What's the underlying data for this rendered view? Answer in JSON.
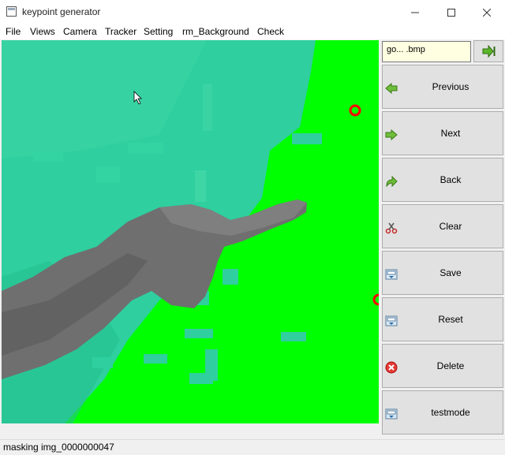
{
  "window": {
    "title": "keypoint generator"
  },
  "menu": [
    "File",
    "Views",
    "Camera",
    "Tracker",
    "Setting",
    "rm_Background",
    "Check"
  ],
  "sidebar": {
    "file_name": "go... .bmp",
    "buttons": [
      {
        "label": "Previous",
        "icon": "arrow-left-icon"
      },
      {
        "label": "Next",
        "icon": "arrow-right-icon"
      },
      {
        "label": "Back",
        "icon": "back-arrow-icon"
      },
      {
        "label": "Clear",
        "icon": "scissors-icon"
      },
      {
        "label": "Save",
        "icon": "save-icon"
      },
      {
        "label": "Reset",
        "icon": "reset-icon"
      },
      {
        "label": "Delete",
        "icon": "delete-icon"
      },
      {
        "label": "testmode",
        "icon": "testmode-icon"
      }
    ]
  },
  "status": {
    "text": "masking img_0000000047"
  },
  "colors": {
    "mask_green": "#00ff00",
    "background_teal": "#2fcf9f",
    "keypoint_red": "#ff0000",
    "button_face": "#e1e1e1"
  }
}
